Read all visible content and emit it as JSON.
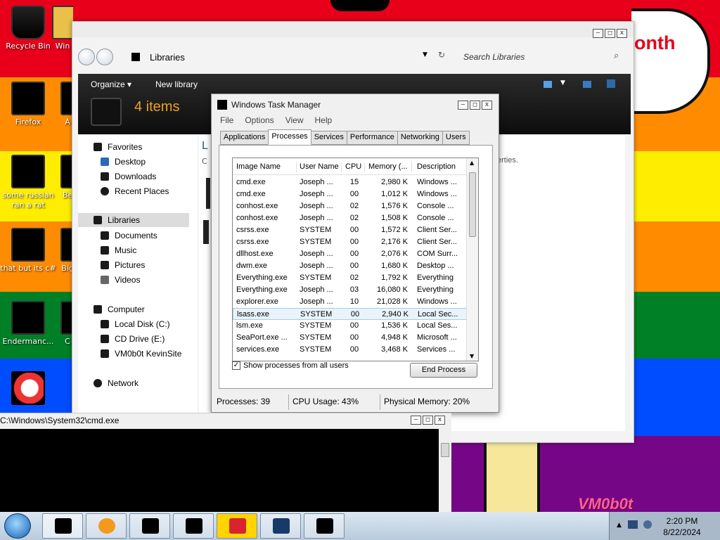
{
  "desktop": {
    "background_colors": [
      "#e8001a",
      "#ff8c00",
      "#ffed00",
      "#008026",
      "#004dff",
      "#750787"
    ],
    "icons": [
      {
        "label": "Recycle Bin",
        "icon": "recycle-bin-icon"
      },
      {
        "label": "Win",
        "icon": "folder-icon"
      },
      {
        "label": "Firefox",
        "icon": "firefox-icon"
      },
      {
        "label": "A",
        "icon": "app-icon"
      },
      {
        "label": "some russian ran a rat",
        "icon": "app-icon"
      },
      {
        "label": "Be",
        "icon": "app-icon"
      },
      {
        "label": "that but its c#",
        "icon": "app-icon"
      },
      {
        "label": "Big",
        "icon": "app-icon"
      },
      {
        "label": "Endermanc...",
        "icon": "app-icon"
      },
      {
        "label": "C",
        "icon": "app-icon"
      }
    ],
    "speech_bubble_text": "onth",
    "wallpaper_text": "VM0b0t"
  },
  "explorer": {
    "address": "Libraries",
    "search_placeholder": "Search Libraries",
    "toolbar": {
      "organize": "Organize ▾",
      "new_library": "New library"
    },
    "items_count": "4 items",
    "content_fragment_1": "L",
    "content_fragment_2": "C",
    "content_fragment_3": "erties.",
    "nav": {
      "favorites": "Favorites",
      "desktop": "Desktop",
      "downloads": "Downloads",
      "recent_places": "Recent Places",
      "libraries": "Libraries",
      "documents": "Documents",
      "music": "Music",
      "pictures": "Pictures",
      "videos": "Videos",
      "computer": "Computer",
      "local_disk": "Local Disk (C:)",
      "cd_drive": "CD Drive (E:)",
      "vm_drive": "VM0b0t KevinSite",
      "network": "Network"
    },
    "window_buttons": {
      "min": "–",
      "max": "□",
      "close": "x"
    }
  },
  "task_manager": {
    "title": "Windows Task Manager",
    "menu": [
      "File",
      "Options",
      "View",
      "Help"
    ],
    "tabs": [
      "Applications",
      "Processes",
      "Services",
      "Performance",
      "Networking",
      "Users"
    ],
    "active_tab": "Processes",
    "columns": [
      "Image Name",
      "User Name",
      "CPU",
      "Memory (...",
      "Description"
    ],
    "rows": [
      {
        "image": "cmd.exe",
        "user": "Joseph ...",
        "cpu": "15",
        "mem": "2,980 K",
        "desc": "Windows ..."
      },
      {
        "image": "cmd.exe",
        "user": "Joseph ...",
        "cpu": "00",
        "mem": "1,012 K",
        "desc": "Windows ..."
      },
      {
        "image": "conhost.exe",
        "user": "Joseph ...",
        "cpu": "02",
        "mem": "1,576 K",
        "desc": "Console ..."
      },
      {
        "image": "conhost.exe",
        "user": "Joseph ...",
        "cpu": "02",
        "mem": "1,508 K",
        "desc": "Console ..."
      },
      {
        "image": "csrss.exe",
        "user": "SYSTEM",
        "cpu": "00",
        "mem": "1,572 K",
        "desc": "Client Ser..."
      },
      {
        "image": "csrss.exe",
        "user": "SYSTEM",
        "cpu": "00",
        "mem": "2,176 K",
        "desc": "Client Ser..."
      },
      {
        "image": "dllhost.exe",
        "user": "Joseph ...",
        "cpu": "00",
        "mem": "2,076 K",
        "desc": "COM Surr..."
      },
      {
        "image": "dwm.exe",
        "user": "Joseph ...",
        "cpu": "00",
        "mem": "1,680 K",
        "desc": "Desktop ..."
      },
      {
        "image": "Everything.exe",
        "user": "SYSTEM",
        "cpu": "02",
        "mem": "1,792 K",
        "desc": "Everything"
      },
      {
        "image": "Everything.exe",
        "user": "Joseph ...",
        "cpu": "03",
        "mem": "16,080 K",
        "desc": "Everything"
      },
      {
        "image": "explorer.exe",
        "user": "Joseph ...",
        "cpu": "10",
        "mem": "21,028 K",
        "desc": "Windows ..."
      },
      {
        "image": "lsass.exe",
        "user": "SYSTEM",
        "cpu": "00",
        "mem": "2,940 K",
        "desc": "Local Sec..."
      },
      {
        "image": "lsm.exe",
        "user": "SYSTEM",
        "cpu": "00",
        "mem": "1,536 K",
        "desc": "Local Ses..."
      },
      {
        "image": "SeaPort.exe ...",
        "user": "SYSTEM",
        "cpu": "00",
        "mem": "4,948 K",
        "desc": "Microsoft ..."
      },
      {
        "image": "services.exe",
        "user": "SYSTEM",
        "cpu": "00",
        "mem": "3,468 K",
        "desc": "Services ..."
      }
    ],
    "selected_row": "lsass.exe",
    "show_all_label": "Show processes from all users",
    "show_all_checked": "✓",
    "end_process": "End Process",
    "status": {
      "processes": "Processes: 39",
      "cpu": "CPU Usage: 43%",
      "memory": "Physical Memory: 20%"
    }
  },
  "cmd": {
    "title": "C:\\Windows\\System32\\cmd.exe"
  },
  "taskbar": {
    "time": "2:20 PM",
    "date": "8/22/2024"
  }
}
